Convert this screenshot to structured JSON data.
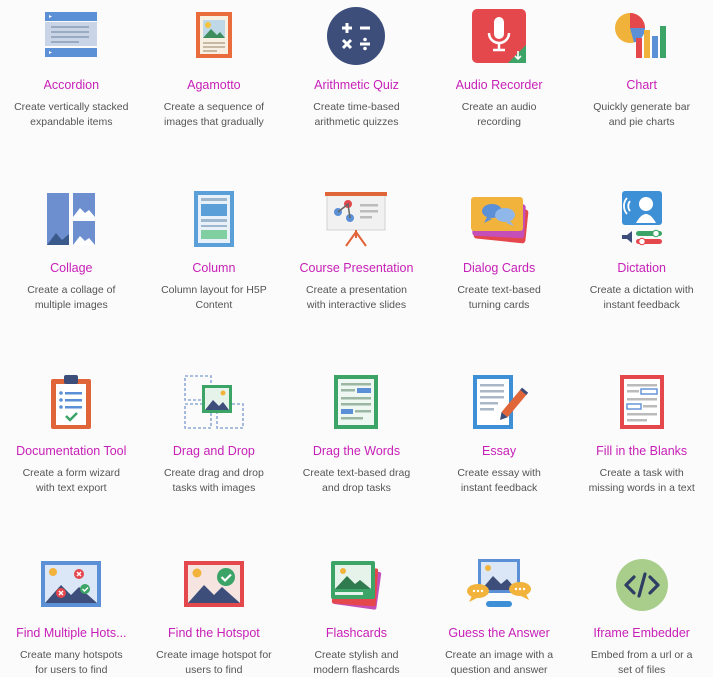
{
  "colors": {
    "title": "#c71fb7",
    "description": "#555555",
    "background": "#fbfbfb"
  },
  "items": [
    {
      "title": "Accordion",
      "description": "Create vertically stacked expandable items",
      "icon": "accordion-icon"
    },
    {
      "title": "Agamotto",
      "description": "Create a sequence of images that gradually",
      "icon": "agamotto-icon"
    },
    {
      "title": "Arithmetic Quiz",
      "description": "Create time-based arithmetic quizzes",
      "icon": "arithmetic-icon"
    },
    {
      "title": "Audio Recorder",
      "description": "Create an audio recording",
      "icon": "microphone-icon"
    },
    {
      "title": "Chart",
      "description": "Quickly generate bar and pie charts",
      "icon": "chart-icon"
    },
    {
      "title": "Collage",
      "description": "Create a collage of multiple images",
      "icon": "collage-icon"
    },
    {
      "title": "Column",
      "description": "Column layout for H5P Content",
      "icon": "column-icon"
    },
    {
      "title": "Course Presentation",
      "description": "Create a presentation with interactive slides",
      "icon": "presentation-icon"
    },
    {
      "title": "Dialog Cards",
      "description": "Create text-based turning cards",
      "icon": "dialog-cards-icon"
    },
    {
      "title": "Dictation",
      "description": "Create a dictation with instant feedback",
      "icon": "dictation-icon"
    },
    {
      "title": "Documentation Tool",
      "description": "Create a form wizard with text export",
      "icon": "clipboard-icon"
    },
    {
      "title": "Drag and Drop",
      "description": "Create drag and drop tasks with images",
      "icon": "drag-drop-icon"
    },
    {
      "title": "Drag the Words",
      "description": "Create text-based drag and drop tasks",
      "icon": "drag-words-icon"
    },
    {
      "title": "Essay",
      "description": "Create essay with instant feedback",
      "icon": "essay-icon"
    },
    {
      "title": "Fill in the Blanks",
      "description": "Create a task with missing words in a text",
      "icon": "fill-blanks-icon"
    },
    {
      "title": "Find Multiple Hots...",
      "description": "Create many hotspots for users to find",
      "icon": "multi-hotspot-icon"
    },
    {
      "title": "Find the Hotspot",
      "description": "Create image hotspot for users to find",
      "icon": "hotspot-icon"
    },
    {
      "title": "Flashcards",
      "description": "Create stylish and modern flashcards",
      "icon": "flashcards-icon"
    },
    {
      "title": "Guess the Answer",
      "description": "Create an image with a question and answer",
      "icon": "guess-answer-icon"
    },
    {
      "title": "Iframe Embedder",
      "description": "Embed from a url or a set of files",
      "icon": "code-icon"
    }
  ]
}
